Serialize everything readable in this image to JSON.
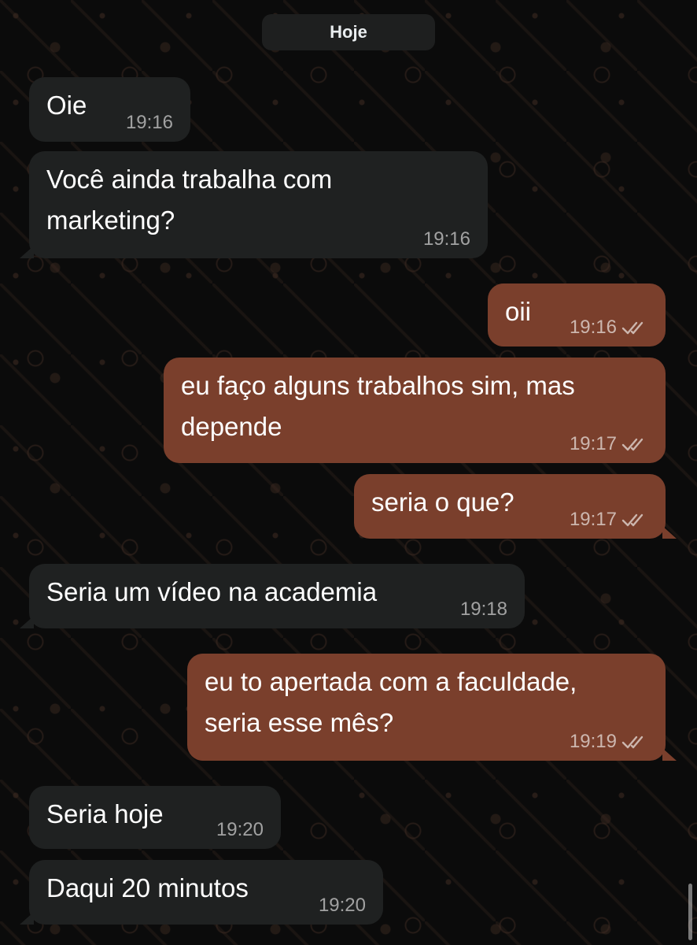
{
  "date_separator": "Hoje",
  "messages": [
    {
      "direction": "incoming",
      "text": "Oie",
      "time": "19:16"
    },
    {
      "direction": "incoming",
      "text": "Você ainda trabalha com\nmarketing?",
      "time": "19:16"
    },
    {
      "direction": "outgoing",
      "text": "oii",
      "time": "19:16",
      "status": "read-double-check-icon"
    },
    {
      "direction": "outgoing",
      "text": "eu faço alguns trabalhos sim, mas\ndepende",
      "time": "19:17",
      "status": "read-double-check-icon"
    },
    {
      "direction": "outgoing",
      "text": "seria o que?",
      "time": "19:17",
      "status": "read-double-check-icon"
    },
    {
      "direction": "incoming",
      "text": "Seria um vídeo na academia",
      "time": "19:18"
    },
    {
      "direction": "outgoing",
      "text": "eu to apertada com a faculdade,\nseria esse mês?",
      "time": "19:19",
      "status": "read-double-check-icon"
    },
    {
      "direction": "incoming",
      "text": "Seria hoje",
      "time": "19:20"
    },
    {
      "direction": "incoming",
      "text": "Daqui 20 minutos",
      "time": "19:20"
    }
  ],
  "colors": {
    "background": "#0b0b0b",
    "incoming_bubble": "#1f2121",
    "outgoing_bubble": "#7a3f2c",
    "text": "#ffffff"
  }
}
